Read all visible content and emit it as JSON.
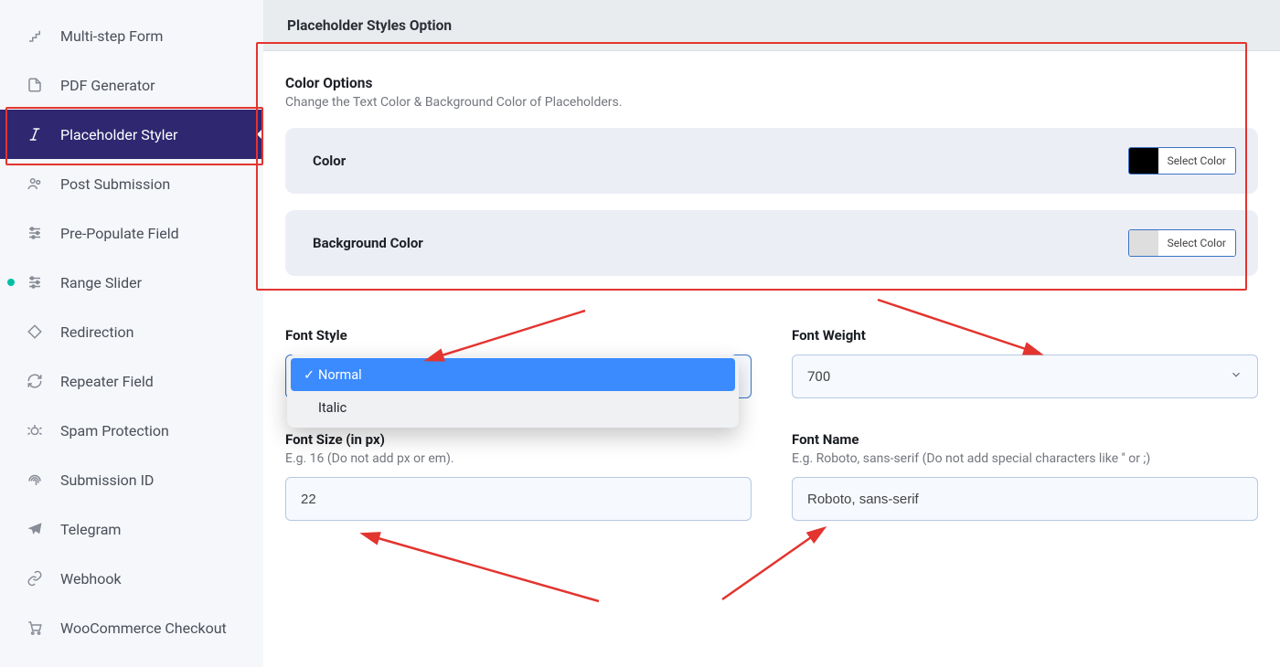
{
  "sidebar": {
    "items": [
      {
        "id": "multistep",
        "label": "Multi-step Form",
        "icon": "stairs-icon",
        "dot": false,
        "active": false
      },
      {
        "id": "pdfgen",
        "label": "PDF Generator",
        "icon": "pdf-file-icon",
        "dot": false,
        "active": false
      },
      {
        "id": "placeholder",
        "label": "Placeholder Styler",
        "icon": "italic-type-icon",
        "dot": false,
        "active": true
      },
      {
        "id": "postsub",
        "label": "Post Submission",
        "icon": "people-icon",
        "dot": false,
        "active": false
      },
      {
        "id": "prepop",
        "label": "Pre-Populate Field",
        "icon": "sliders-icon",
        "dot": false,
        "active": false
      },
      {
        "id": "range",
        "label": "Range Slider",
        "icon": "sliders-icon",
        "dot": true,
        "active": false
      },
      {
        "id": "redir",
        "label": "Redirection",
        "icon": "diamond-icon",
        "dot": false,
        "active": false
      },
      {
        "id": "repeater",
        "label": "Repeater Field",
        "icon": "refresh-icon",
        "dot": false,
        "active": false
      },
      {
        "id": "spam",
        "label": "Spam Protection",
        "icon": "bug-icon",
        "dot": false,
        "active": false
      },
      {
        "id": "subid",
        "label": "Submission ID",
        "icon": "fingerprint-icon",
        "dot": false,
        "active": false
      },
      {
        "id": "telegram",
        "label": "Telegram",
        "icon": "telegram-icon",
        "dot": false,
        "active": false
      },
      {
        "id": "webhook",
        "label": "Webhook",
        "icon": "link-icon",
        "dot": false,
        "active": false
      },
      {
        "id": "woo",
        "label": "WooCommerce Checkout",
        "icon": "cart-icon",
        "dot": false,
        "active": false
      }
    ]
  },
  "header": {
    "title": "Placeholder Styles Option"
  },
  "color_section": {
    "title": "Color Options",
    "subtitle": "Change the Text Color & Background Color of Placeholders.",
    "rows": [
      {
        "label": "Color",
        "swatch": "#000000",
        "button": "Select Color"
      },
      {
        "label": "Background Color",
        "swatch": "#dedede",
        "button": "Select Color"
      }
    ]
  },
  "font_style": {
    "label": "Font Style",
    "value": "Normal",
    "options": [
      {
        "label": "Normal",
        "selected": true
      },
      {
        "label": "Italic",
        "selected": false
      }
    ]
  },
  "font_weight": {
    "label": "Font Weight",
    "value": "700"
  },
  "font_size": {
    "label": "Font Size (in px)",
    "hint": "E.g. 16 (Do not add px or em).",
    "value": "22"
  },
  "font_name": {
    "label": "Font Name",
    "hint": "E.g. Roboto, sans-serif (Do not add special characters like '' or ;)",
    "value": "Roboto, sans-serif"
  }
}
